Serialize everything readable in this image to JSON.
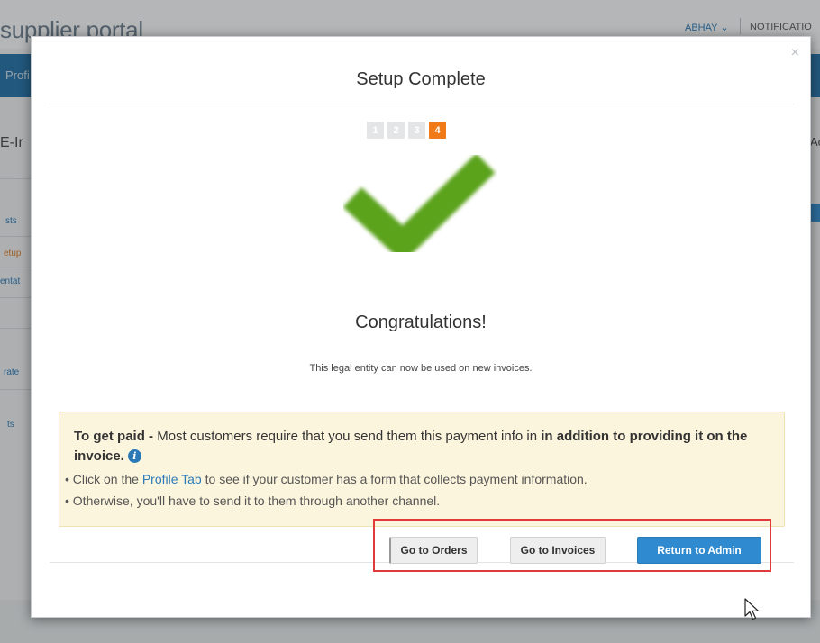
{
  "background": {
    "logo": "supplier portal",
    "user": "ABHAY ⌄",
    "notifications": "NOTIFICATIO",
    "nav_tab": "Profi",
    "page_title": "E-Ir",
    "right_char": "Ac",
    "side_items": [
      "sts",
      "etup",
      "entat",
      "rate",
      "ts"
    ]
  },
  "modal": {
    "title": "Setup Complete",
    "close_label": "×",
    "steps": [
      "1",
      "2",
      "3",
      "4"
    ],
    "active_step": "4",
    "congrats": "Congratulations!",
    "entity_message": "This legal entity can now be used on new invoices.",
    "callout": {
      "lead_bold": "To get paid -",
      "lead_text": " Most customers require that you send them this payment info in ",
      "lead_bold_2": "in addition to providing it on the invoice.",
      "info_icon": "i",
      "bullet_1_prefix": "• Click on the ",
      "bullet_1_link": "Profile Tab",
      "bullet_1_suffix": " to see if your customer has a form that collects payment information.",
      "bullet_2": "• Otherwise, you'll have to send it to them through another channel."
    },
    "buttons": {
      "orders": "Go to Orders",
      "invoices": "Go to Invoices",
      "admin": "Return to Admin"
    }
  },
  "colors": {
    "primary": "#2f8ad0",
    "step_active": "#f07a17",
    "check_green": "#5ca31c",
    "highlight_red": "#e03a3a",
    "callout_bg": "#fcf5dd"
  }
}
